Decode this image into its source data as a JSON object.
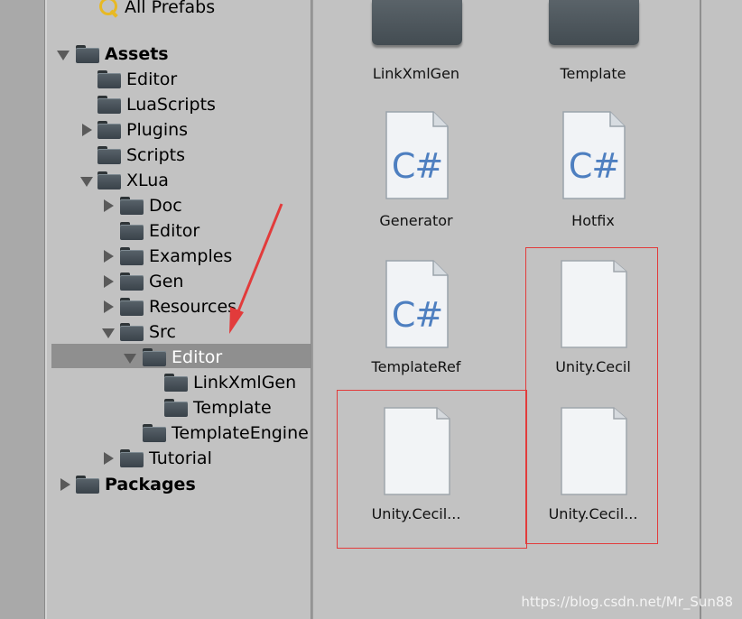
{
  "tree": {
    "all_prefabs": "All Prefabs",
    "assets": "Assets",
    "editor": "Editor",
    "luascripts": "LuaScripts",
    "plugins": "Plugins",
    "scripts": "Scripts",
    "xlua": "XLua",
    "doc": "Doc",
    "xlua_editor": "Editor",
    "examples": "Examples",
    "gen": "Gen",
    "resources": "Resources",
    "src": "Src",
    "src_editor": "Editor",
    "linkxmlgen": "LinkXmlGen",
    "template": "Template",
    "templateengine": "TemplateEngine",
    "tutorial": "Tutorial",
    "packages": "Packages"
  },
  "grid": {
    "items": [
      {
        "name": "LinkXmlGen",
        "kind": "folder"
      },
      {
        "name": "Template",
        "kind": "folder"
      },
      {
        "name": "Generator",
        "kind": "csharp"
      },
      {
        "name": "Hotfix",
        "kind": "csharp"
      },
      {
        "name": "TemplateRef",
        "kind": "csharp"
      },
      {
        "name": "Unity.Cecil",
        "kind": "file"
      },
      {
        "name": "Unity.Cecil...",
        "kind": "file"
      },
      {
        "name": "Unity.Cecil...",
        "kind": "file"
      }
    ],
    "cs_glyph": "C#"
  },
  "watermark": "https://blog.csdn.net/Mr_Sun88",
  "colors": {
    "background": "#c2c2c2",
    "selection": "#8f8f8f",
    "annotation_red": "#e23b3b",
    "csharp_blue": "#4e7fc0"
  }
}
